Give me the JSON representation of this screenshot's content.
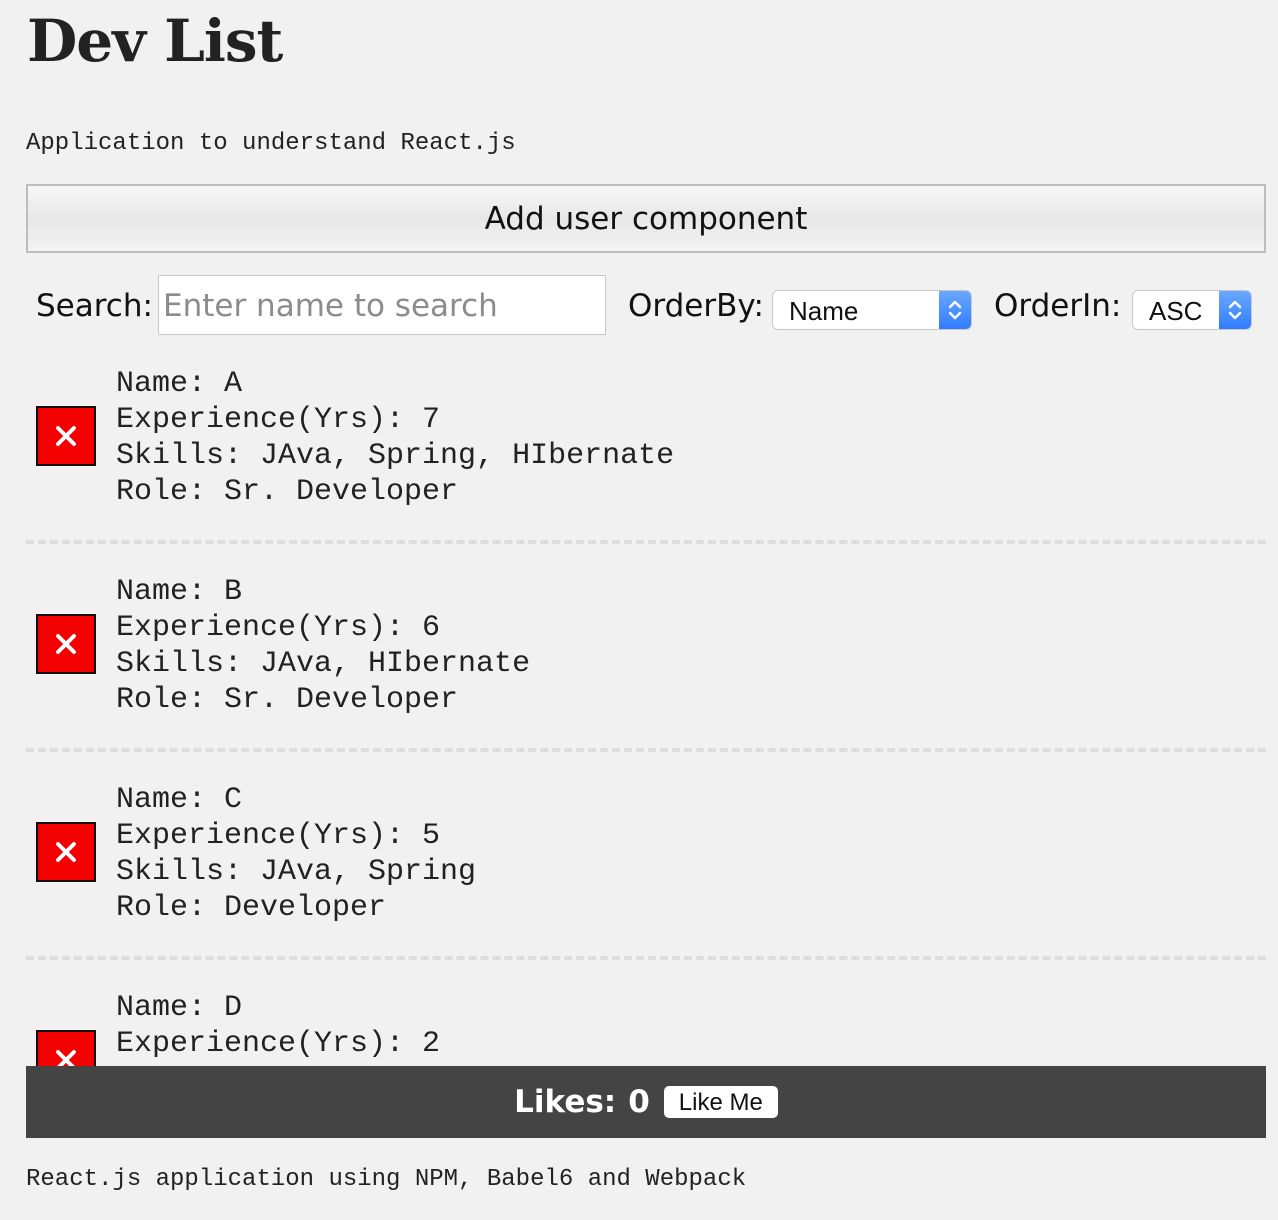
{
  "app": {
    "title": "Dev List",
    "subtitle": "Application to understand React.js"
  },
  "actions": {
    "add_user_label": "Add user component"
  },
  "controls": {
    "search_label": "Search:",
    "search_placeholder": "Enter name to search",
    "search_value": "",
    "orderby_label": "OrderBy:",
    "orderby_value": "Name",
    "orderin_label": "OrderIn:",
    "orderin_value": "ASC"
  },
  "users": [
    {
      "name_line": "Name: A",
      "experience_line": "Experience(Yrs): 7",
      "skills_line": "Skills: JAva, Spring, HIbernate",
      "role_line": "Role: Sr. Developer"
    },
    {
      "name_line": "Name: B",
      "experience_line": "Experience(Yrs): 6",
      "skills_line": "Skills: JAva, HIbernate",
      "role_line": "Role: Sr. Developer"
    },
    {
      "name_line": "Name: C",
      "experience_line": "Experience(Yrs): 5",
      "skills_line": "Skills: JAva, Spring",
      "role_line": "Role: Developer"
    },
    {
      "name_line": "Name: D",
      "experience_line": "Experience(Yrs): 2"
    }
  ],
  "likes": {
    "label": "Likes:",
    "count": "0",
    "button_label": "Like Me"
  },
  "footer": {
    "text": "React.js application using NPM, Babel6 and Webpack"
  },
  "icons": {
    "delete": "close-icon",
    "select_arrow": "chevron-up-down-icon"
  },
  "colors": {
    "background": "#f1f1f1",
    "delete_red": "#f40000",
    "likes_bar": "#444444",
    "select_accent": "#2f7cff"
  }
}
